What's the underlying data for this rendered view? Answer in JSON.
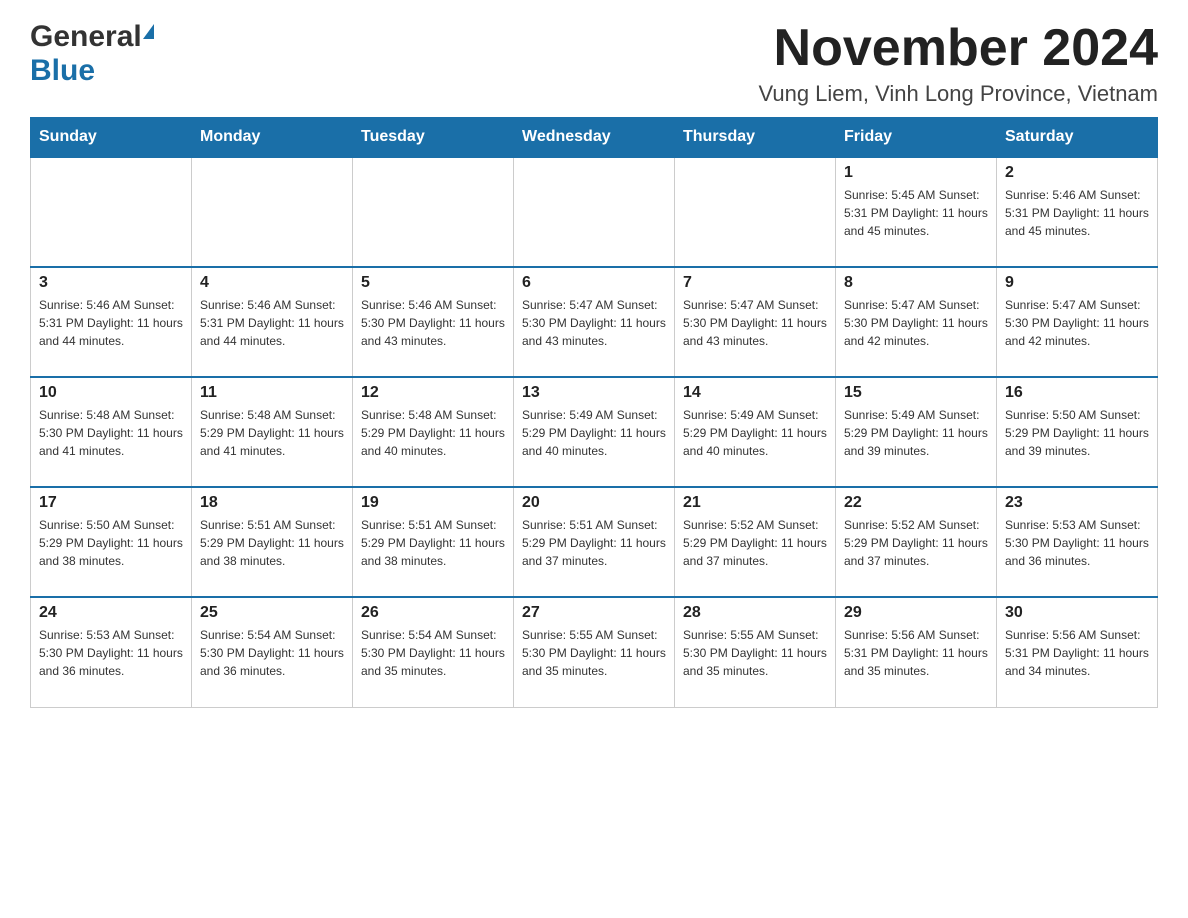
{
  "logo": {
    "general": "General",
    "blue": "Blue"
  },
  "header": {
    "title": "November 2024",
    "location": "Vung Liem, Vinh Long Province, Vietnam"
  },
  "days_of_week": [
    "Sunday",
    "Monday",
    "Tuesday",
    "Wednesday",
    "Thursday",
    "Friday",
    "Saturday"
  ],
  "weeks": [
    [
      {
        "day": "",
        "info": ""
      },
      {
        "day": "",
        "info": ""
      },
      {
        "day": "",
        "info": ""
      },
      {
        "day": "",
        "info": ""
      },
      {
        "day": "",
        "info": ""
      },
      {
        "day": "1",
        "info": "Sunrise: 5:45 AM\nSunset: 5:31 PM\nDaylight: 11 hours and 45 minutes."
      },
      {
        "day": "2",
        "info": "Sunrise: 5:46 AM\nSunset: 5:31 PM\nDaylight: 11 hours and 45 minutes."
      }
    ],
    [
      {
        "day": "3",
        "info": "Sunrise: 5:46 AM\nSunset: 5:31 PM\nDaylight: 11 hours and 44 minutes."
      },
      {
        "day": "4",
        "info": "Sunrise: 5:46 AM\nSunset: 5:31 PM\nDaylight: 11 hours and 44 minutes."
      },
      {
        "day": "5",
        "info": "Sunrise: 5:46 AM\nSunset: 5:30 PM\nDaylight: 11 hours and 43 minutes."
      },
      {
        "day": "6",
        "info": "Sunrise: 5:47 AM\nSunset: 5:30 PM\nDaylight: 11 hours and 43 minutes."
      },
      {
        "day": "7",
        "info": "Sunrise: 5:47 AM\nSunset: 5:30 PM\nDaylight: 11 hours and 43 minutes."
      },
      {
        "day": "8",
        "info": "Sunrise: 5:47 AM\nSunset: 5:30 PM\nDaylight: 11 hours and 42 minutes."
      },
      {
        "day": "9",
        "info": "Sunrise: 5:47 AM\nSunset: 5:30 PM\nDaylight: 11 hours and 42 minutes."
      }
    ],
    [
      {
        "day": "10",
        "info": "Sunrise: 5:48 AM\nSunset: 5:30 PM\nDaylight: 11 hours and 41 minutes."
      },
      {
        "day": "11",
        "info": "Sunrise: 5:48 AM\nSunset: 5:29 PM\nDaylight: 11 hours and 41 minutes."
      },
      {
        "day": "12",
        "info": "Sunrise: 5:48 AM\nSunset: 5:29 PM\nDaylight: 11 hours and 40 minutes."
      },
      {
        "day": "13",
        "info": "Sunrise: 5:49 AM\nSunset: 5:29 PM\nDaylight: 11 hours and 40 minutes."
      },
      {
        "day": "14",
        "info": "Sunrise: 5:49 AM\nSunset: 5:29 PM\nDaylight: 11 hours and 40 minutes."
      },
      {
        "day": "15",
        "info": "Sunrise: 5:49 AM\nSunset: 5:29 PM\nDaylight: 11 hours and 39 minutes."
      },
      {
        "day": "16",
        "info": "Sunrise: 5:50 AM\nSunset: 5:29 PM\nDaylight: 11 hours and 39 minutes."
      }
    ],
    [
      {
        "day": "17",
        "info": "Sunrise: 5:50 AM\nSunset: 5:29 PM\nDaylight: 11 hours and 38 minutes."
      },
      {
        "day": "18",
        "info": "Sunrise: 5:51 AM\nSunset: 5:29 PM\nDaylight: 11 hours and 38 minutes."
      },
      {
        "day": "19",
        "info": "Sunrise: 5:51 AM\nSunset: 5:29 PM\nDaylight: 11 hours and 38 minutes."
      },
      {
        "day": "20",
        "info": "Sunrise: 5:51 AM\nSunset: 5:29 PM\nDaylight: 11 hours and 37 minutes."
      },
      {
        "day": "21",
        "info": "Sunrise: 5:52 AM\nSunset: 5:29 PM\nDaylight: 11 hours and 37 minutes."
      },
      {
        "day": "22",
        "info": "Sunrise: 5:52 AM\nSunset: 5:29 PM\nDaylight: 11 hours and 37 minutes."
      },
      {
        "day": "23",
        "info": "Sunrise: 5:53 AM\nSunset: 5:30 PM\nDaylight: 11 hours and 36 minutes."
      }
    ],
    [
      {
        "day": "24",
        "info": "Sunrise: 5:53 AM\nSunset: 5:30 PM\nDaylight: 11 hours and 36 minutes."
      },
      {
        "day": "25",
        "info": "Sunrise: 5:54 AM\nSunset: 5:30 PM\nDaylight: 11 hours and 36 minutes."
      },
      {
        "day": "26",
        "info": "Sunrise: 5:54 AM\nSunset: 5:30 PM\nDaylight: 11 hours and 35 minutes."
      },
      {
        "day": "27",
        "info": "Sunrise: 5:55 AM\nSunset: 5:30 PM\nDaylight: 11 hours and 35 minutes."
      },
      {
        "day": "28",
        "info": "Sunrise: 5:55 AM\nSunset: 5:30 PM\nDaylight: 11 hours and 35 minutes."
      },
      {
        "day": "29",
        "info": "Sunrise: 5:56 AM\nSunset: 5:31 PM\nDaylight: 11 hours and 35 minutes."
      },
      {
        "day": "30",
        "info": "Sunrise: 5:56 AM\nSunset: 5:31 PM\nDaylight: 11 hours and 34 minutes."
      }
    ]
  ]
}
